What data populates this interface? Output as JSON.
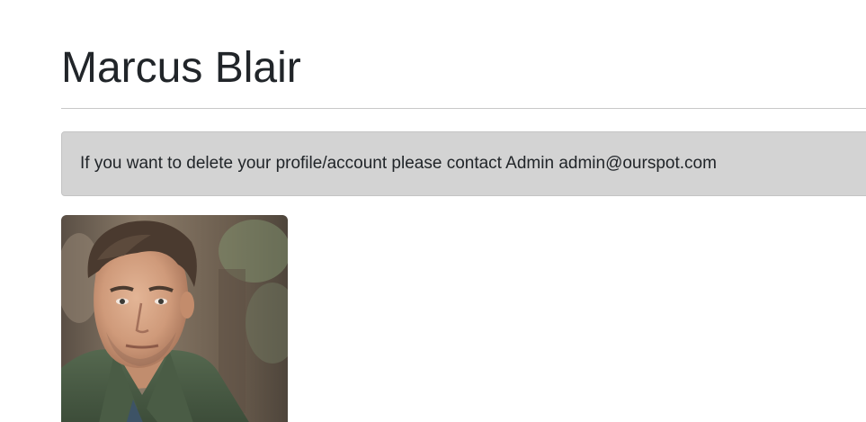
{
  "profile": {
    "name": "Marcus Blair"
  },
  "notice": {
    "text": "If you want to delete your profile/account please contact Admin admin@ourspot.com"
  },
  "photo": {
    "icon": "profile-photo"
  },
  "colors": {
    "notice_background": "#d3d3d3",
    "title_text": "#212529",
    "divider": "#c8c8c8"
  }
}
